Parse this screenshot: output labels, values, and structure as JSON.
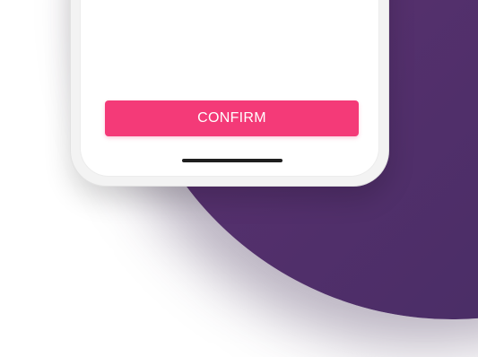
{
  "colors": {
    "background": "#ffffff",
    "backdrop": "#55306d",
    "accent": "#f43a78",
    "screen": "#ffffff",
    "device_frame": "#f3f3f3",
    "home_indicator": "#1f1f1f"
  },
  "screen": {
    "confirm_button": {
      "label": "CONFIRM"
    },
    "home_indicator_icon": "home-indicator-bar"
  }
}
